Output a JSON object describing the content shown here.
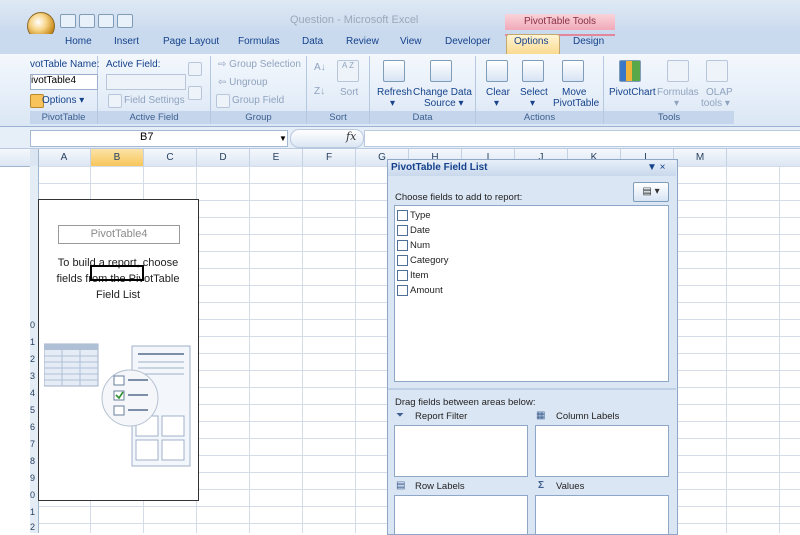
{
  "window": {
    "doc_title": "Question - Microsoft Excel",
    "contextual_tab_group": "PivotTable Tools"
  },
  "tabs": [
    "Home",
    "Insert",
    "Page Layout",
    "Formulas",
    "Data",
    "Review",
    "View",
    "Developer",
    "Options",
    "Design"
  ],
  "active_tab": "Options",
  "ribbon": {
    "pivottable": {
      "name_label": "votTable Name:",
      "name_value": "ivotTable4",
      "options_label": "Options",
      "group_label": "PivotTable"
    },
    "active_field": {
      "label": "Active Field:",
      "field_settings": "Field Settings",
      "group_label": "Active Field"
    },
    "group": {
      "group_selection": "Group Selection",
      "ungroup": "Ungroup",
      "group_field": "Group Field",
      "group_label": "Group"
    },
    "sort": {
      "az": "A Z",
      "za": "Z A",
      "sort": "Sort",
      "group_label": "Sort"
    },
    "data": {
      "refresh": "Refresh",
      "change_source_1": "Change Data",
      "change_source_2": "Source",
      "group_label": "Data"
    },
    "actions": {
      "clear": "Clear",
      "select": "Select",
      "move_1": "Move",
      "move_2": "PivotTable",
      "group_label": "Actions"
    },
    "tools": {
      "pivotchart": "PivotChart",
      "formulas": "Formulas",
      "olap_1": "OLAP",
      "olap_2": "tools",
      "group_label": "Tools"
    }
  },
  "formula_bar": {
    "name_box": "B7",
    "fx": "fx",
    "formula": ""
  },
  "columns": [
    "A",
    "B",
    "C",
    "D",
    "E",
    "F",
    "G",
    "H",
    "I",
    "J",
    "K",
    "L",
    "M"
  ],
  "selected_column": "B",
  "row_numbers": [
    "0",
    "1",
    "2",
    "3",
    "4",
    "5",
    "6",
    "7",
    "8",
    "9",
    "0",
    "1",
    "2"
  ],
  "pivot_placeholder": {
    "title": "PivotTable4",
    "instruction": "To build a report, choose fields from the PivotTable Field List"
  },
  "field_list_pane": {
    "title": "PivotTable Field List",
    "controls": "▼ ×",
    "choose_text": "Choose fields to add to report:",
    "fields": [
      "Type",
      "Date",
      "Num",
      "Category",
      "Item",
      "Amount"
    ],
    "drag_text": "Drag fields between areas below:",
    "areas": {
      "report_filter": "Report Filter",
      "column_labels": "Column Labels",
      "row_labels": "Row Labels",
      "values": "Values"
    }
  }
}
